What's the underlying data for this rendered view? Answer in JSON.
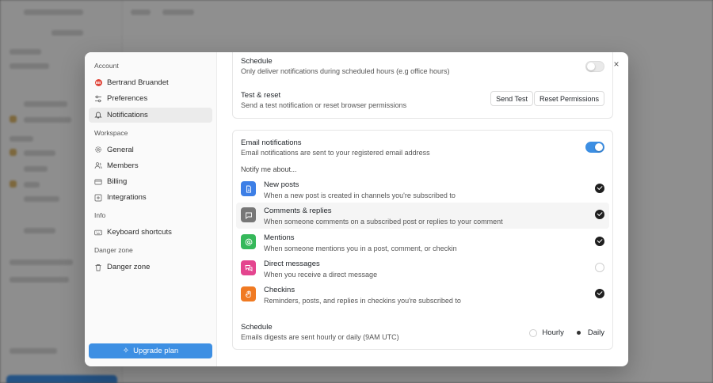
{
  "sidebar": {
    "sections": {
      "account": "Account",
      "workspace": "Workspace",
      "info": "Info",
      "danger": "Danger zone"
    },
    "avatar_initials": "BB",
    "items": {
      "user": "Bertrand Bruandet",
      "preferences": "Preferences",
      "notifications": "Notifications",
      "general": "General",
      "members": "Members",
      "billing": "Billing",
      "integrations": "Integrations",
      "keyboard": "Keyboard shortcuts",
      "danger_zone": "Danger zone"
    },
    "upgrade_label": "Upgrade plan"
  },
  "settings": {
    "schedule_title": "Schedule",
    "schedule_sub": "Only deliver notifications during scheduled hours (e.g office hours)",
    "test_title": "Test & reset",
    "test_sub": "Send a test notification or reset browser permissions",
    "send_test": "Send Test",
    "reset_permissions": "Reset Permissions"
  },
  "email": {
    "title": "Email notifications",
    "sub": "Email notifications are sent to your registered email address",
    "notify_label": "Notify me about...",
    "items": [
      {
        "title": "New posts",
        "sub": "When a new post is created in channels you're subscribed to",
        "checked": true,
        "color": "#3d7fe6"
      },
      {
        "title": "Comments & replies",
        "sub": "When someone comments on a subscribed post or replies to your comment",
        "checked": true,
        "color": "#777777"
      },
      {
        "title": "Mentions",
        "sub": "When someone mentions you in a post, comment, or checkin",
        "checked": true,
        "color": "#35b85a"
      },
      {
        "title": "Direct messages",
        "sub": "When you receive a direct message",
        "checked": false,
        "color": "#e4458f"
      },
      {
        "title": "Checkins",
        "sub": "Reminders, posts, and replies in checkins you're subscribed to",
        "checked": true,
        "color": "#f07a22"
      }
    ],
    "schedule_title": "Schedule",
    "schedule_sub": "Emails digests are sent hourly or daily (9AM UTC)",
    "hourly": "Hourly",
    "daily": "Daily"
  }
}
